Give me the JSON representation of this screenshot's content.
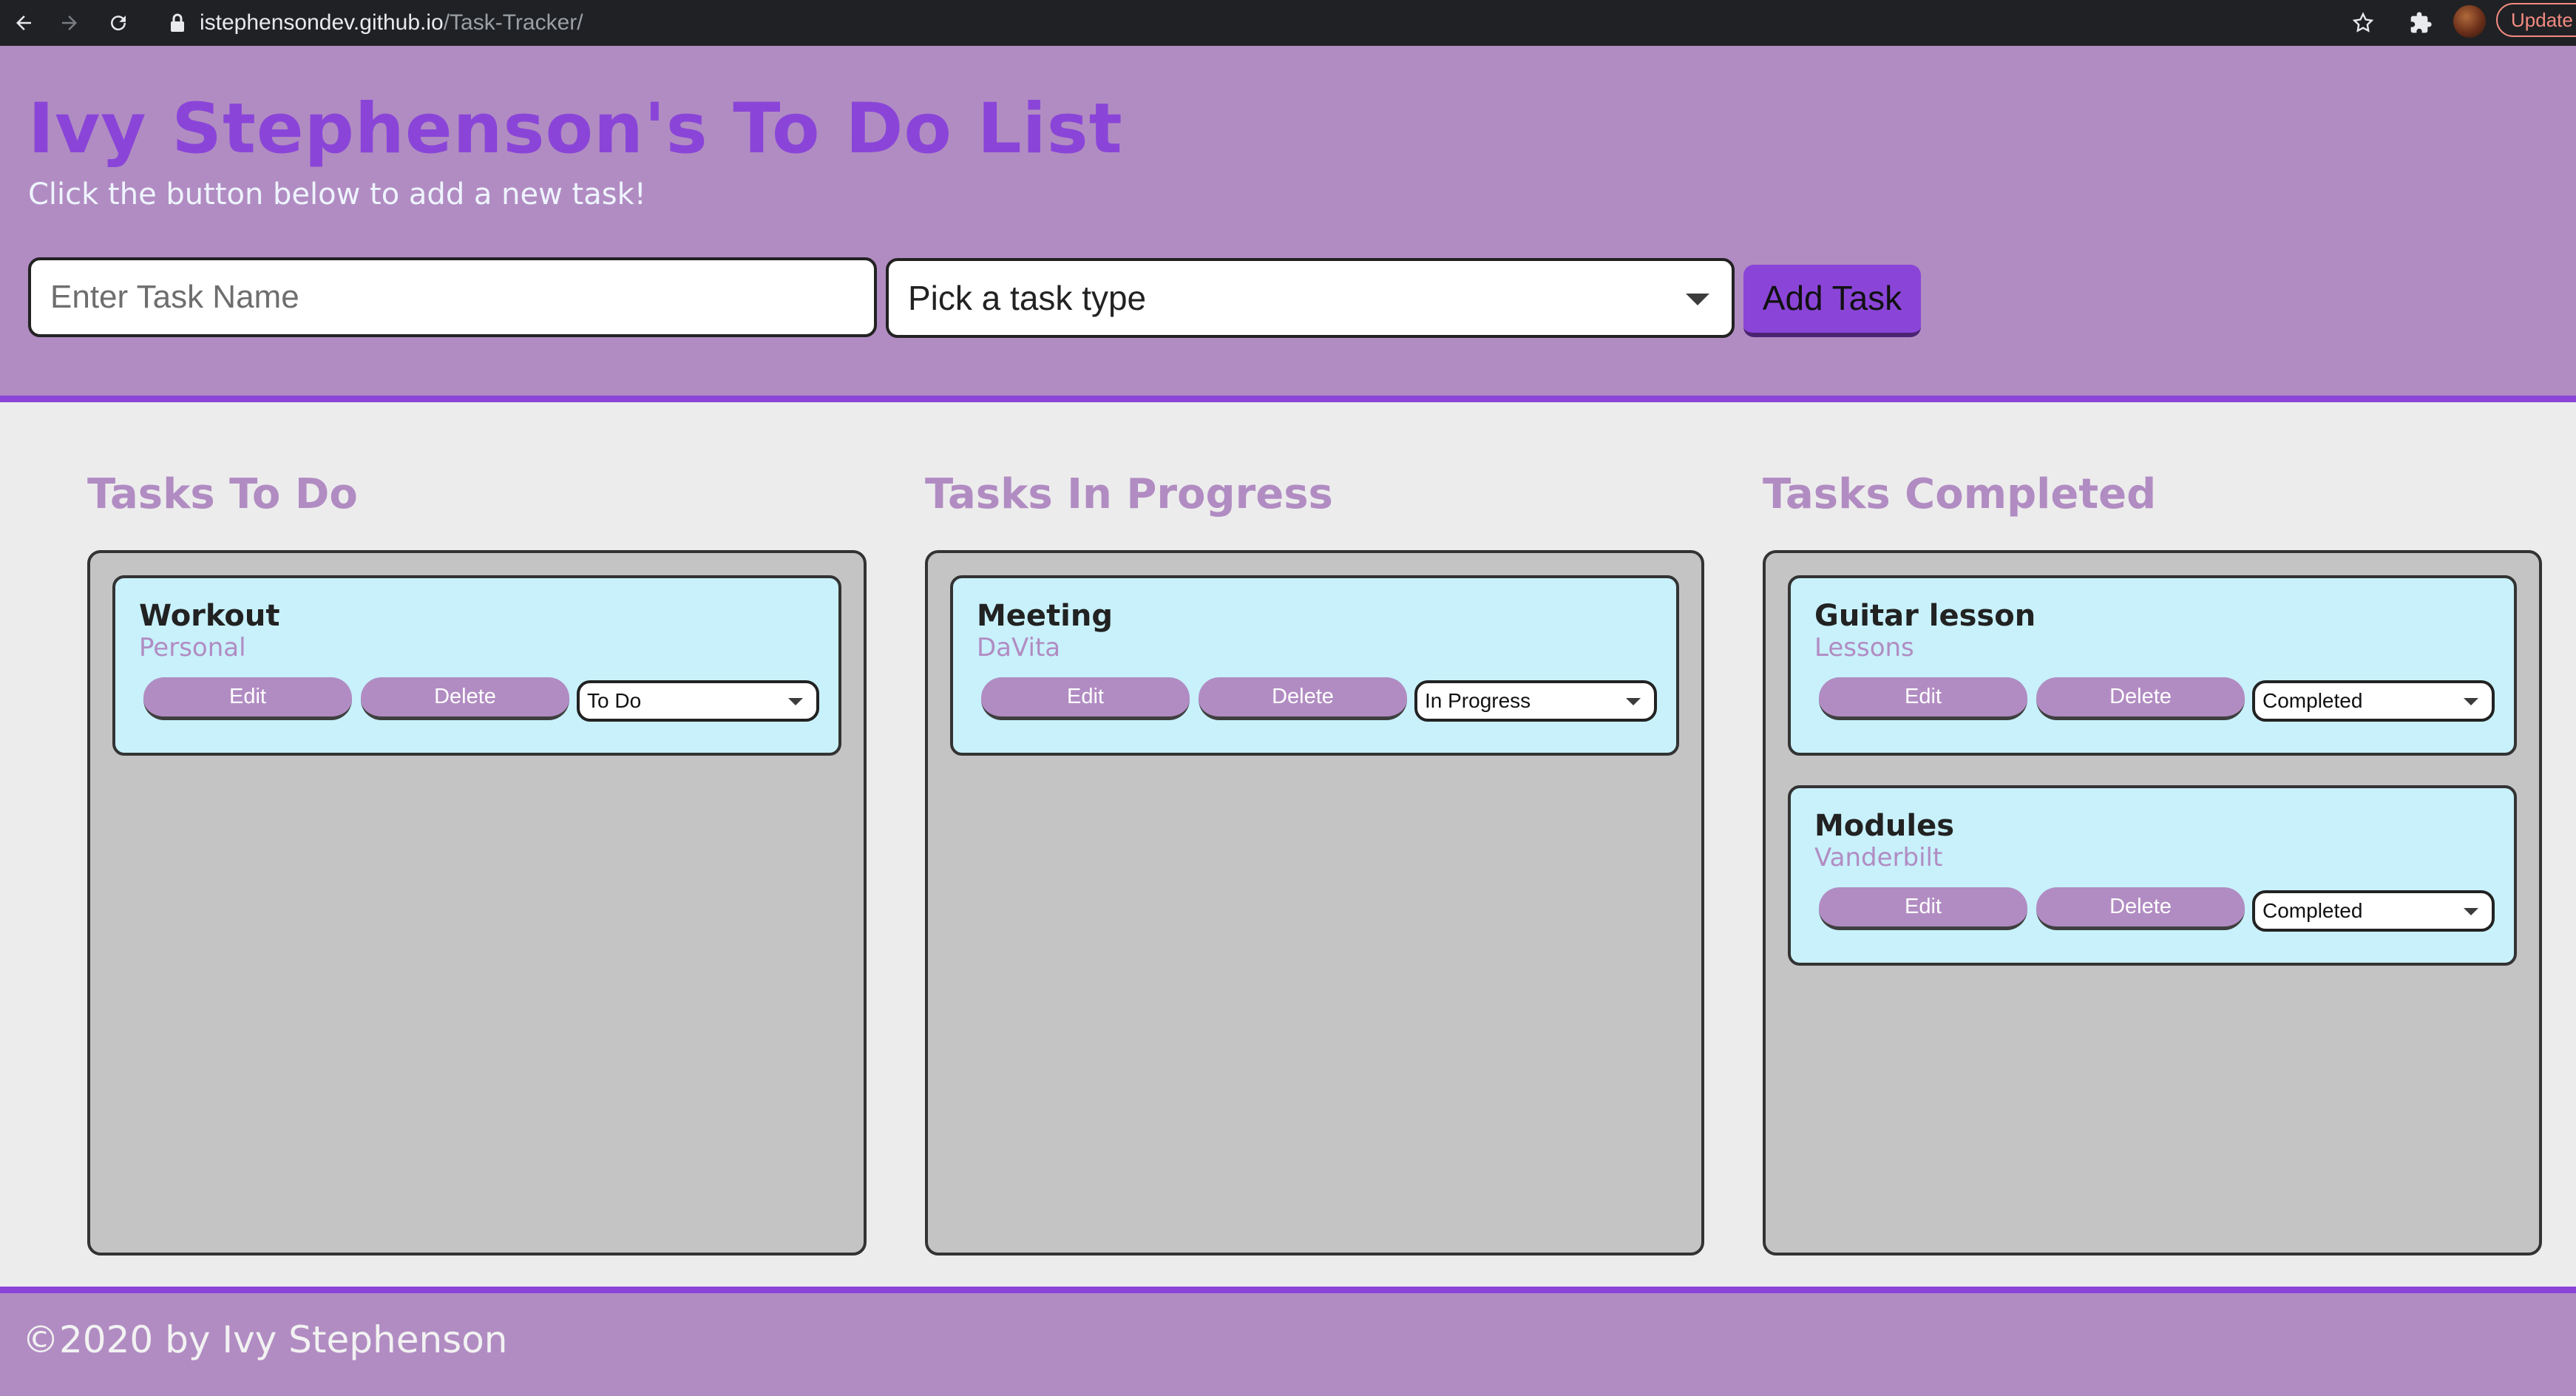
{
  "browser": {
    "url_domain": "istephensondev.github.io",
    "url_path": "/Task-Tracker/",
    "update_label": "Update"
  },
  "header": {
    "title": "Ivy Stephenson's To Do List",
    "subtitle": "Click the button below to add a new task!",
    "task_input_placeholder": "Enter Task Name",
    "task_type_selected": "Pick a task type",
    "add_button": "Add Task"
  },
  "columns": [
    {
      "title": "Tasks To Do",
      "tasks": [
        {
          "name": "Workout",
          "type": "Personal",
          "status": "To Do"
        }
      ]
    },
    {
      "title": "Tasks In Progress",
      "tasks": [
        {
          "name": "Meeting",
          "type": "DaVita",
          "status": "In Progress"
        }
      ]
    },
    {
      "title": "Tasks Completed",
      "tasks": [
        {
          "name": "Guitar lesson",
          "type": "Lessons",
          "status": "Completed"
        },
        {
          "name": "Modules",
          "type": "Vanderbilt",
          "status": "Completed"
        }
      ]
    }
  ],
  "card_buttons": {
    "edit": "Edit",
    "delete": "Delete"
  },
  "footer": {
    "text": "©2020 by Ivy Stephenson"
  },
  "colors": {
    "header_bg": "#b18cc2",
    "accent_purple": "#8a45d8",
    "card_bg": "#c8f1fb",
    "panel_bg": "#c4c4c4",
    "page_bg": "#ececec"
  }
}
